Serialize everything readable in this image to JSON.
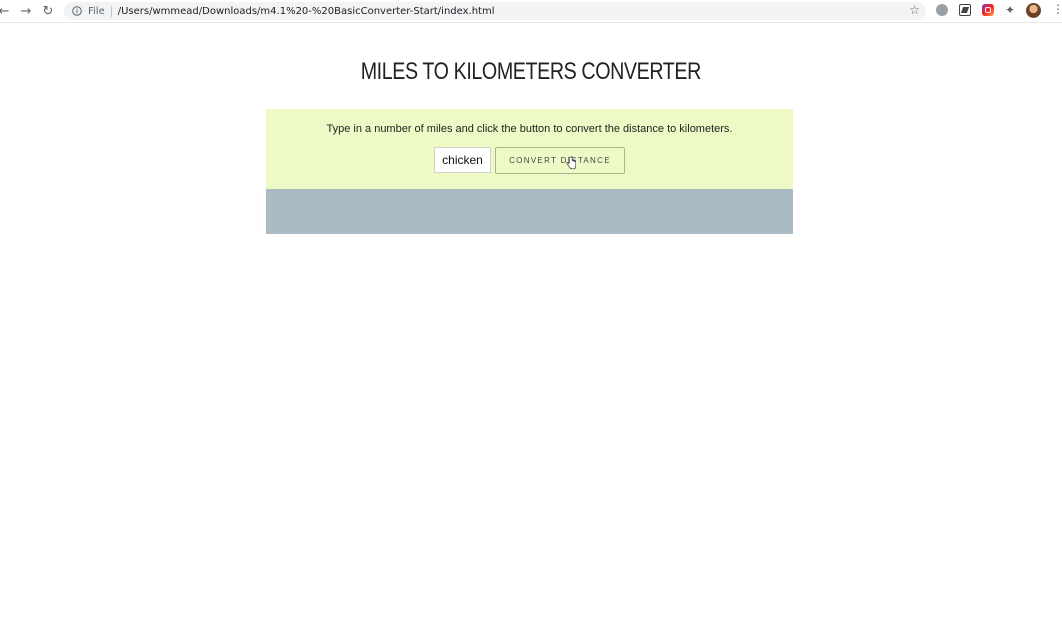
{
  "browser": {
    "back_glyph": "←",
    "forward_glyph": "→",
    "reload_glyph": "↻",
    "file_label": "File",
    "url": "/Users/wmmead/Downloads/m4.1%20-%20BasicConverter-Start/index.html",
    "star_glyph": "☆",
    "puzzle_glyph": "✦",
    "menu_glyph": "⋮"
  },
  "page": {
    "title": "MILES TO KILOMETERS CONVERTER",
    "instructions": "Type in a number of miles and click the button to convert the distance to kilometers.",
    "miles_input_value": "chicken",
    "convert_button_label": "CONVERT DISTANCE",
    "result_text": ""
  },
  "colors": {
    "converter_panel_bg": "#eefac5",
    "result_panel_bg": "#aabbc6"
  }
}
